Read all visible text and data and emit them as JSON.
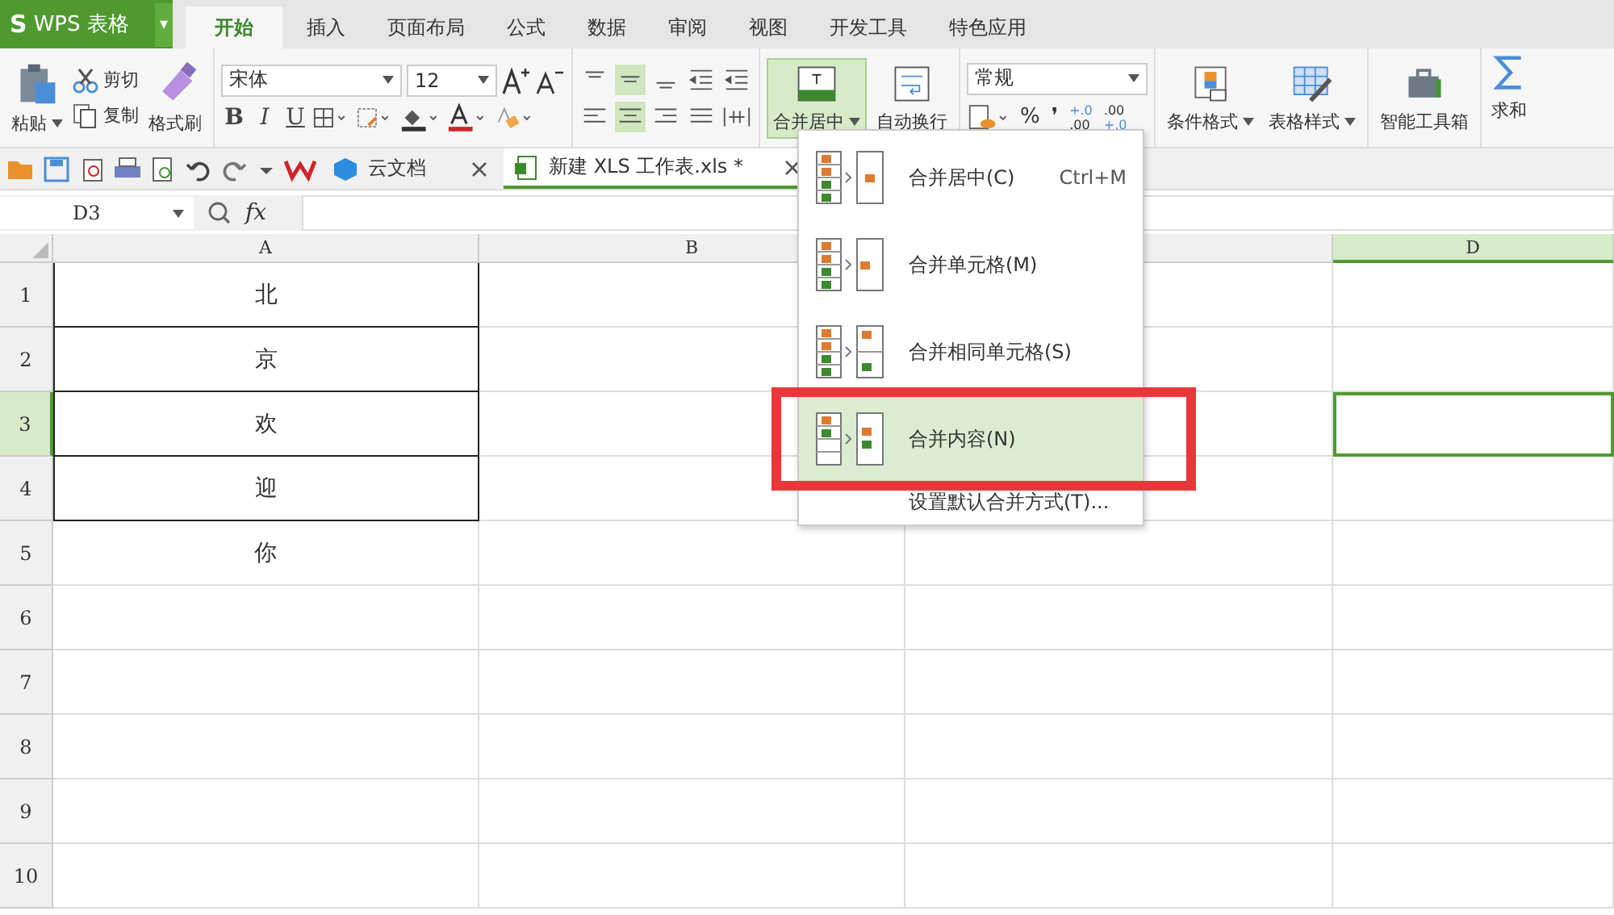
{
  "app": {
    "logo": "S",
    "title": "WPS 表格",
    "caret": "▾"
  },
  "ribbon_tabs": [
    {
      "label": "开始",
      "selected": true
    },
    {
      "label": "插入",
      "selected": false
    },
    {
      "label": "页面布局",
      "selected": false
    },
    {
      "label": "公式",
      "selected": false
    },
    {
      "label": "数据",
      "selected": false
    },
    {
      "label": "审阅",
      "selected": false
    },
    {
      "label": "视图",
      "selected": false
    },
    {
      "label": "开发工具",
      "selected": false
    },
    {
      "label": "特色应用",
      "selected": false
    }
  ],
  "clipboard": {
    "paste": "粘贴",
    "cut": "剪切",
    "copy": "复制",
    "format_painter": "格式刷"
  },
  "font": {
    "family": "宋体",
    "size": "12",
    "bold": "B",
    "italic": "I",
    "underline": "U"
  },
  "alignment": {
    "merge": "合并居中",
    "wrap": "自动换行",
    "merge_open": true
  },
  "number": {
    "format": "常规",
    "percent": "%",
    "comma": "❜",
    "increase_decimal": [
      "+.0",
      ".00"
    ],
    "decrease_decimal": [
      ".00",
      "+.0"
    ]
  },
  "styles": {
    "conditional": "条件格式",
    "table_style": "表格样式",
    "toolbox": "智能工具箱",
    "sum": "求和"
  },
  "doc_tabs": [
    {
      "label": "云文档",
      "selected": false
    },
    {
      "label": "新建 XLS 工作表.xls *",
      "selected": true
    }
  ],
  "formula_bar": {
    "name_box": "D3",
    "fx": "fx"
  },
  "columns": [
    {
      "label": "A",
      "selected": false
    },
    {
      "label": "B",
      "selected": false
    },
    {
      "selected": false
    },
    {
      "label": "D",
      "selected": true
    }
  ],
  "rows": [
    {
      "number": "1",
      "selected": false,
      "bordered": true,
      "value": "北"
    },
    {
      "number": "2",
      "selected": false,
      "bordered": true,
      "value": "京"
    },
    {
      "number": "3",
      "selected": true,
      "bordered": true,
      "value": "欢"
    },
    {
      "number": "4",
      "selected": false,
      "bordered": true,
      "value": "迎"
    },
    {
      "number": "5",
      "selected": false,
      "bordered": false,
      "value": "你"
    },
    {
      "number": "6",
      "selected": false,
      "bordered": false
    },
    {
      "number": "7",
      "selected": false,
      "bordered": false
    },
    {
      "number": "8",
      "selected": false,
      "bordered": false
    },
    {
      "number": "9",
      "selected": false,
      "bordered": false
    },
    {
      "number": "10",
      "selected": false,
      "bordered": false
    }
  ],
  "merge_menu": [
    {
      "kind": "center",
      "label": "合并居中(C)",
      "shortcut": "Ctrl+M",
      "selected": false,
      "annotated": false
    },
    {
      "kind": "merge",
      "label": "合并单元格(M)",
      "selected": false,
      "annotated": false
    },
    {
      "kind": "same",
      "label": "合并相同单元格(S)",
      "selected": false,
      "annotated": false
    },
    {
      "kind": "content",
      "label": "合并内容(N)",
      "selected": true,
      "annotated": true
    },
    {
      "kind": "plain",
      "label": "设置默认合并方式(T)...",
      "selected": false,
      "annotated": false
    }
  ]
}
